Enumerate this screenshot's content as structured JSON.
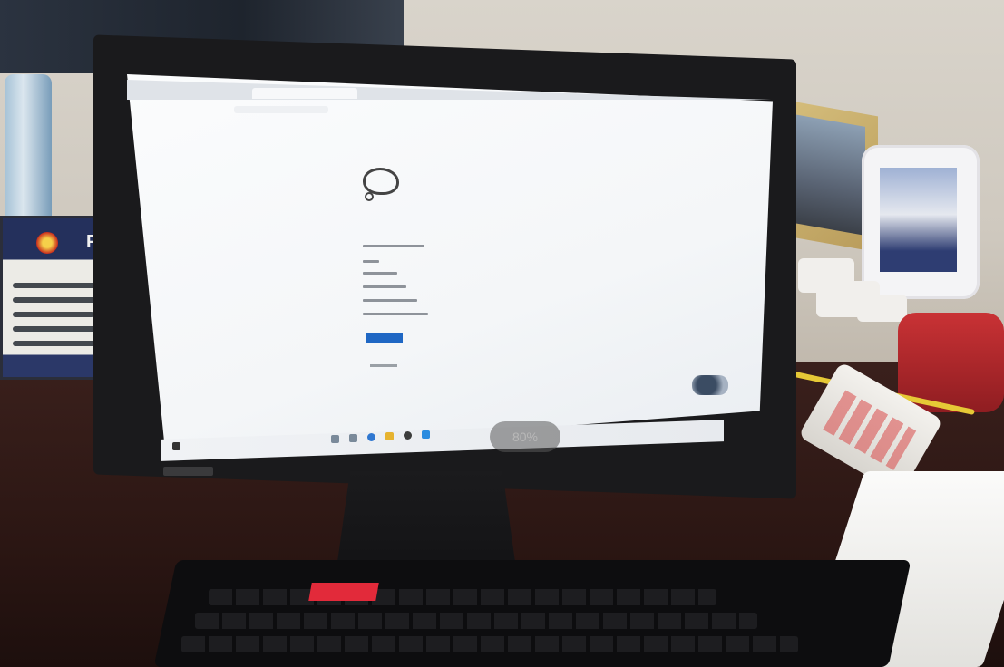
{
  "photo": {
    "description_type": "photograph of a monitor showing a browser error page",
    "sign_text": "PC",
    "zoom_indicator": "80%"
  },
  "colors": {
    "browser_button": "#1f67c4",
    "desk": "#2b1613",
    "wall": "#d9d4cb",
    "phone": "#c93235"
  }
}
